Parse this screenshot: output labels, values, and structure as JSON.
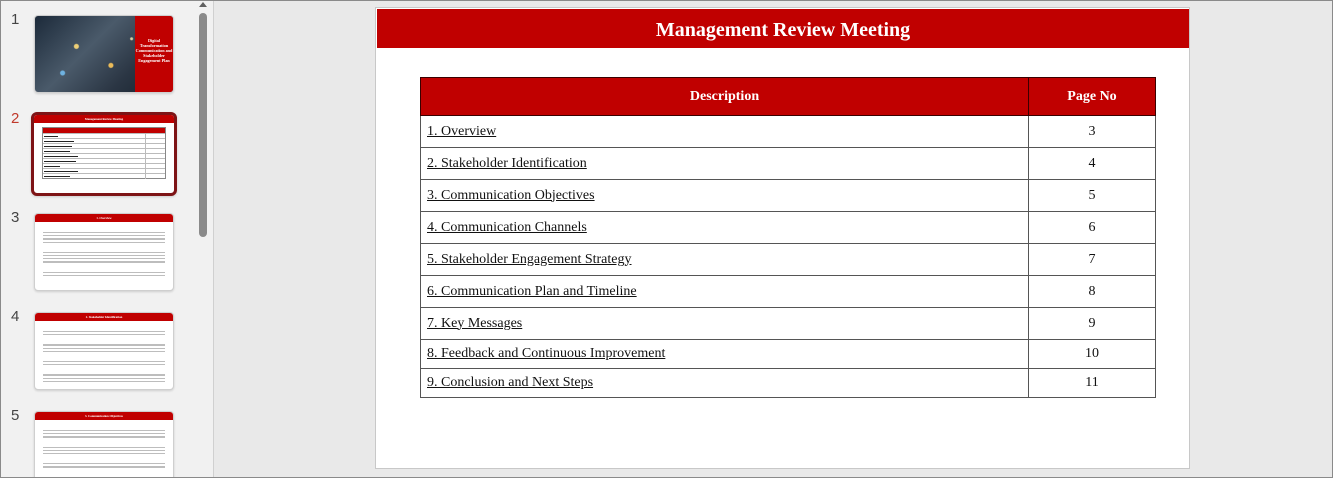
{
  "thumbnails": [
    {
      "number": "1",
      "cover_text": "Digital Transformation Communication and Stakeholder Engagement Plan"
    },
    {
      "number": "2",
      "title": "Management Review Meeting"
    },
    {
      "number": "3",
      "title": "1. Overview"
    },
    {
      "number": "4",
      "title": "2. Stakeholder Identification"
    },
    {
      "number": "5",
      "title": "3. Communication Objectives"
    }
  ],
  "slide": {
    "title": "Management Review Meeting",
    "table": {
      "headers": {
        "description": "Description",
        "page": "Page No"
      },
      "rows": [
        {
          "description": "1. Overview",
          "page": "3"
        },
        {
          "description": "2. Stakeholder Identification",
          "page": "4"
        },
        {
          "description": "3. Communication Objectives",
          "page": "5"
        },
        {
          "description": "4. Communication Channels",
          "page": "6"
        },
        {
          "description": "5. Stakeholder Engagement Strategy",
          "page": "7"
        },
        {
          "description": "6. Communication Plan and Timeline",
          "page": "8"
        },
        {
          "description": "7. Key Messages",
          "page": "9"
        },
        {
          "description": "8. Feedback and Continuous Improvement",
          "page": "10"
        },
        {
          "description": "9. Conclusion and Next Steps",
          "page": "11"
        }
      ]
    }
  },
  "colors": {
    "accent": "#c00000",
    "selection": "#7e1416"
  }
}
